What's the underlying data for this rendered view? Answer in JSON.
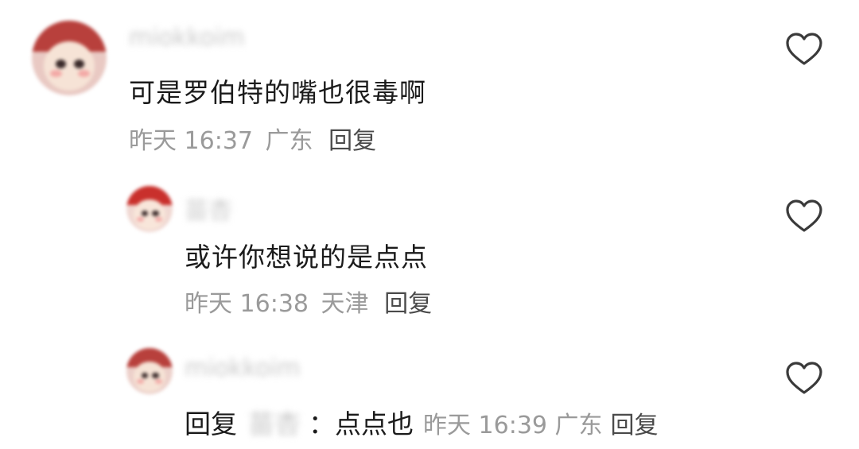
{
  "comments": [
    {
      "username": "miokkoim",
      "text": "可是罗伯特的嘴也很毒啊",
      "time": "昨天 16:37",
      "location": "广东",
      "reply_label": "回复"
    },
    {
      "username": "苗杏",
      "text": "或许你想说的是点点",
      "time": "昨天 16:38",
      "location": "天津",
      "reply_label": "回复"
    },
    {
      "username": "miokkoim",
      "reply_prefix": "回复",
      "reply_to": "苗杏",
      "colon": "：",
      "text": "点点也",
      "time": "昨天 16:39",
      "location": "广东",
      "reply_label": "回复"
    }
  ],
  "icons": {
    "like": "heart-outline-icon"
  },
  "colors": {
    "text_primary": "#1b1b1b",
    "text_secondary": "#9a9a9a",
    "reply_link": "#4a4a4a",
    "icon_stroke": "#3a3a3a"
  }
}
